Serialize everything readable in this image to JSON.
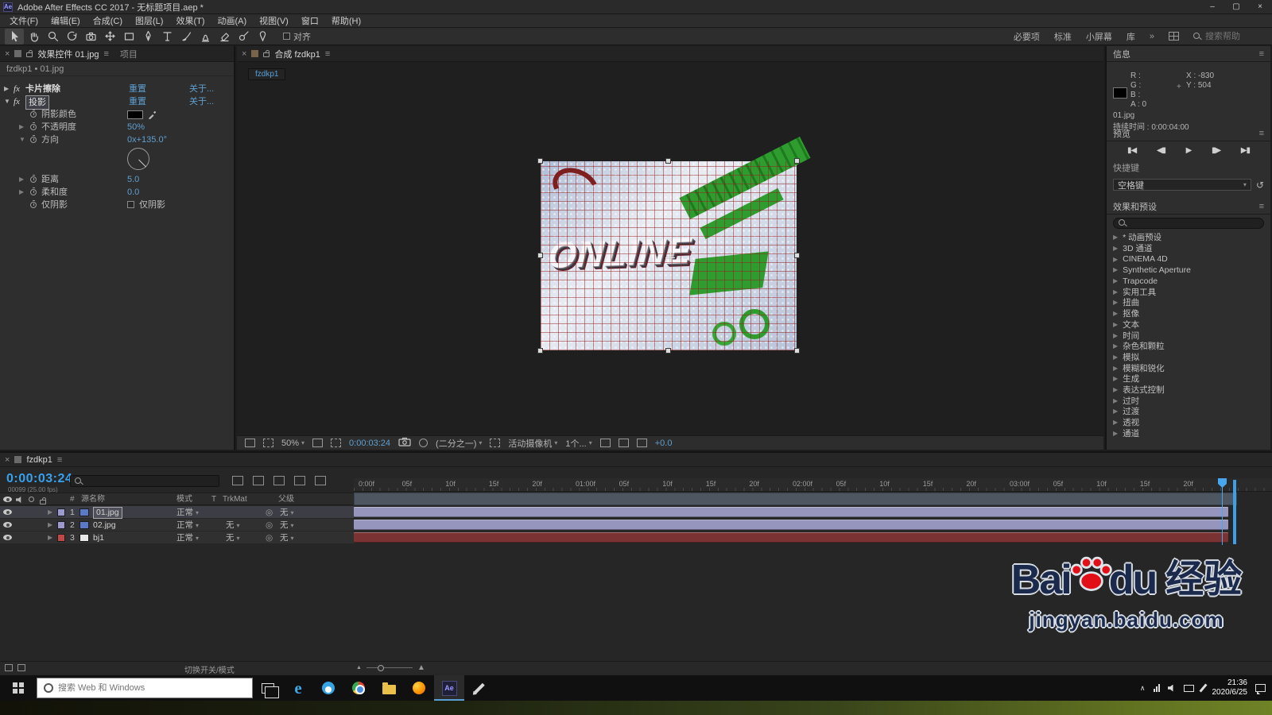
{
  "titlebar": {
    "title": "Adobe After Effects CC 2017 - 无标题项目.aep *"
  },
  "menubar": {
    "items": [
      "文件(F)",
      "编辑(E)",
      "合成(C)",
      "图层(L)",
      "效果(T)",
      "动画(A)",
      "视图(V)",
      "窗口",
      "帮助(H)"
    ]
  },
  "toolbar": {
    "tools": [
      "selection-tool",
      "hand-tool",
      "zoom-tool",
      "rotation-tool",
      "unified-camera-tool",
      "pan-behind-tool",
      "shape-tool",
      "pen-tool",
      "type-tool",
      "brush-tool",
      "clone-stamp-tool",
      "eraser-tool",
      "roto-brush-tool",
      "puppet-pin-tool"
    ],
    "snap_label": "对齐",
    "workspaces": [
      "必要项",
      "标准",
      "小屏幕",
      "库"
    ],
    "overflow": "»",
    "search_placeholder": "搜索帮助"
  },
  "effect_controls": {
    "tab_active": "效果控件 01.jpg",
    "tab_inactive": "项目",
    "comp_label": "fzdkp1 • 01.jpg",
    "reset_label": "重置",
    "about_label": "关于...",
    "effect1": {
      "name": "卡片擦除"
    },
    "effect2": {
      "name": "投影"
    },
    "props": {
      "shadow_color": "阴影颜色",
      "opacity_label": "不透明度",
      "opacity_value": "50%",
      "direction_label": "方向",
      "direction_value": "0x+135.0°",
      "distance_label": "距离",
      "distance_value": "5.0",
      "softness_label": "柔和度",
      "softness_value": "0.0",
      "shadow_only_label": "仅阴影",
      "shadow_only_check": "仅阴影"
    }
  },
  "comp": {
    "tab": "合成 fzdkp1",
    "view_tab": "fzdkp1",
    "image_title": "ONLINE",
    "zoom": "50%",
    "timecode": "0:00:03:24",
    "resolution": "(二分之一)",
    "camera": "活动摄像机",
    "views": "1个...",
    "exposure": "+0.0"
  },
  "info": {
    "title": "信息",
    "r": "R :",
    "g": "G :",
    "b": "B :",
    "a": "A :  0",
    "x": "X : -830",
    "y": "Y :  504",
    "clip": "01.jpg",
    "duration": "持续时间 : 0:00:04:00"
  },
  "preview": {
    "title": "预览"
  },
  "shortcut": {
    "title": "快捷键",
    "value": "空格键"
  },
  "presets": {
    "title": "效果和预设",
    "items": [
      "* 动画预设",
      "3D 通道",
      "CINEMA 4D",
      "Synthetic Aperture",
      "Trapcode",
      "实用工具",
      "扭曲",
      "抠像",
      "文本",
      "时间",
      "杂色和颗粒",
      "模拟",
      "模糊和锐化",
      "生成",
      "表达式控制",
      "过时",
      "过渡",
      "透视",
      "通道"
    ]
  },
  "timeline": {
    "tab": "fzdkp1",
    "timecode": "0:00:03:24",
    "frame_info": "00099 (25.00 fps)",
    "col_num": "#",
    "col_source": "源名称",
    "col_mode": "模式",
    "col_t": "T",
    "col_trkmat": "TrkMat",
    "col_parent": "父级",
    "layers": [
      {
        "num": "1",
        "name": "01.jpg",
        "mode": "正常",
        "trkmat": "",
        "parent": "无",
        "chip": "#9a9ad0",
        "bar": "#9595bd",
        "thumb": "#5b79c9",
        "selected": true
      },
      {
        "num": "2",
        "name": "02.jpg",
        "mode": "正常",
        "trkmat": "无",
        "parent": "无",
        "chip": "#9a9ad0",
        "bar": "#9595bd",
        "thumb": "#5b79c9",
        "selected": false
      },
      {
        "num": "3",
        "name": "bj1",
        "mode": "正常",
        "trkmat": "无",
        "parent": "无",
        "chip": "#c14747",
        "bar": "#7a3232",
        "thumb": "#e8e8e8",
        "selected": false
      }
    ],
    "ruler": [
      "0:00f",
      "05f",
      "10f",
      "15f",
      "20f",
      "01:00f",
      "05f",
      "10f",
      "15f",
      "20f",
      "02:00f",
      "05f",
      "10f",
      "15f",
      "20f",
      "03:00f",
      "05f",
      "10f",
      "15f",
      "20f"
    ],
    "toggle_hint": "切换开关/模式"
  },
  "taskbar": {
    "search_placeholder": "搜索 Web 和 Windows",
    "time": "21:36",
    "date": "2020/6/25"
  },
  "watermark": {
    "part1": "Bai",
    "part2": "du",
    "part3": "经验",
    "url": "jingyan.baidu.com"
  },
  "colors": {
    "accent": "#3ea0e8",
    "value_blue": "#5f9fd0",
    "layer_lavender": "#9595bd",
    "layer_red": "#7a3232"
  }
}
